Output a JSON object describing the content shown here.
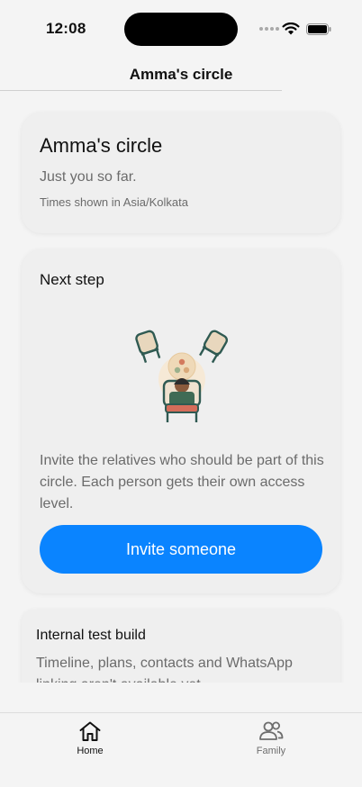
{
  "status_bar": {
    "time": "12:08",
    "icons": [
      "cellular-signal-icon",
      "wifi-icon",
      "battery-icon"
    ]
  },
  "nav": {
    "title": "Amma's circle"
  },
  "circle_card": {
    "title": "Amma's circle",
    "subtitle": "Just you so far.",
    "timezone_note": "Times shown in Asia/Kolkata"
  },
  "next_step_card": {
    "title": "Next step",
    "illustration": "family-chairs-illustration",
    "body": "Invite the relatives who should be part of this circle. Each person gets their own access level.",
    "button_label": "Invite someone"
  },
  "test_card": {
    "title": "Internal test build",
    "body": "Timeline, plans, contacts and WhatsApp linking aren't available yet."
  },
  "tab_bar": {
    "tabs": [
      {
        "label": "Home",
        "icon": "home-icon",
        "active": true
      },
      {
        "label": "Family",
        "icon": "people-icon",
        "active": false
      }
    ]
  },
  "colors": {
    "accent": "#0a84ff",
    "background": "#f4f4f4",
    "card": "#efefef",
    "secondary_text": "#6b6b6b"
  }
}
